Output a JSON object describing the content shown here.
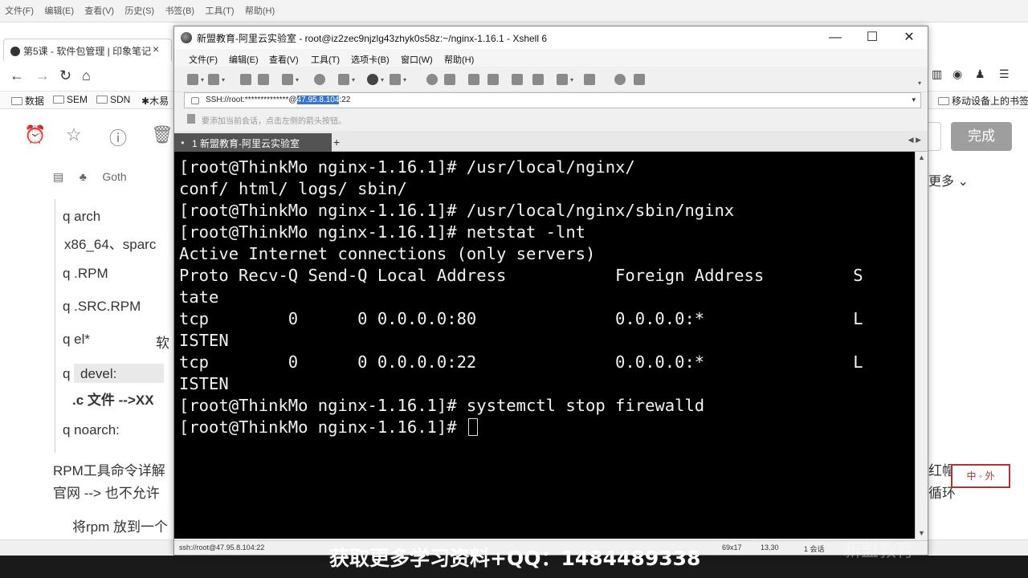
{
  "bg_browser": {
    "menu": [
      "文件(F)",
      "编辑(E)",
      "查看(V)",
      "历史(S)",
      "书签(B)",
      "工具(T)",
      "帮助(H)"
    ],
    "tab_title": "第5课 - 软件包管理 | 印象笔记",
    "tab_close": "×",
    "bookmarks": [
      "数据",
      "SEM",
      "SDN",
      "木易"
    ],
    "mobile_bookmarks": "移动设备上的书签",
    "doc_top": "Goth",
    "doc_items": [
      "q arch",
      "x86_64、sparc",
      "q .RPM",
      "q .SRC.RPM",
      "q el*",
      "软",
      "q",
      "devel:",
      ".c 文件  -->XX",
      "q noarch:"
    ],
    "doc_below": [
      "RPM工具命令详解",
      "官网 -->  也不允许",
      "将rpm 放到一个"
    ],
    "right_more": "更多",
    "right_side_text": [
      "红帽",
      "循环"
    ],
    "done_button": "完成",
    "stamp": "中 ◦ 外"
  },
  "xshell": {
    "title": "新盟教育-阿里云实验室 - root@iz2zec9njzlg43zhyk0s58z:~/nginx-1.16.1 - Xshell 6",
    "window_controls": [
      "—",
      "☐",
      "✕"
    ],
    "menu": [
      "文件(F)",
      "编辑(E)",
      "查看(V)",
      "工具(T)",
      "选项卡(B)",
      "窗口(W)",
      "帮助(H)"
    ],
    "address_prefix": "SSH://root:**************@",
    "address_highlight": "47.95.8.104",
    "address_suffix": ":22",
    "hint": "要添加当前会话，点击左侧的箭头按钮。",
    "tab_label": "1 新盟教育-阿里云实验室",
    "tab_add": "+",
    "tab_nav": "◀ ▶",
    "terminal_lines": [
      "[root@ThinkMo nginx-1.16.1]# /usr/local/nginx/",
      "conf/ html/ logs/ sbin/",
      "[root@ThinkMo nginx-1.16.1]# /usr/local/nginx/sbin/nginx",
      "[root@ThinkMo nginx-1.16.1]# netstat -lnt",
      "Active Internet connections (only servers)",
      "Proto Recv-Q Send-Q Local Address           Foreign Address         S",
      "tate",
      "tcp        0      0 0.0.0.0:80              0.0.0.0:*               L",
      "ISTEN",
      "tcp        0      0 0.0.0.0:22              0.0.0.0:*               L",
      "ISTEN",
      "[root@ThinkMo nginx-1.16.1]# systemctl stop firewalld"
    ],
    "prompt_line": "[root@ThinkMo nginx-1.16.1]# ",
    "status": {
      "connection": "ssh://root@47.95.8.104:22",
      "size": "69x17",
      "cursor": "13,30",
      "sessions": "1 会话"
    }
  },
  "promo_banner": "获取更多学习资料+QQ：1484489338",
  "watermark": "新盟教育"
}
